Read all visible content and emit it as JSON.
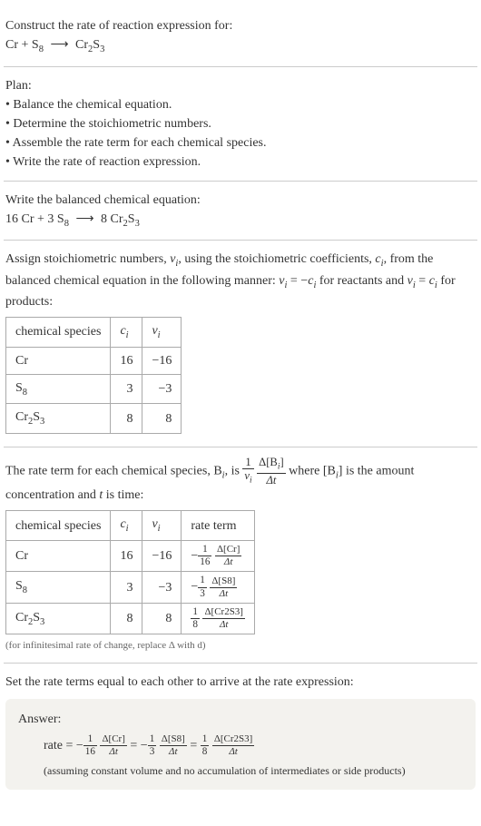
{
  "intro": {
    "prompt": "Construct the rate of reaction expression for:",
    "equation_lhs_1": "Cr",
    "equation_plus": " + ",
    "equation_lhs_2": "S",
    "equation_lhs_2_sub": "8",
    "equation_arrow": "⟶",
    "equation_rhs": "Cr",
    "equation_rhs_sub1": "2",
    "equation_rhs_s": "S",
    "equation_rhs_sub2": "3"
  },
  "plan": {
    "heading": "Plan:",
    "b1": "• Balance the chemical equation.",
    "b2": "• Determine the stoichiometric numbers.",
    "b3": "• Assemble the rate term for each chemical species.",
    "b4": "• Write the rate of reaction expression."
  },
  "balanced": {
    "heading": "Write the balanced chemical equation:",
    "c1": "16 Cr",
    "plus": " + ",
    "c2a": "3 S",
    "c2sub": "8",
    "arrow": "⟶",
    "c3a": "8 Cr",
    "c3sub1": "2",
    "c3b": "S",
    "c3sub2": "3"
  },
  "stoich": {
    "text1": "Assign stoichiometric numbers, ",
    "nu": "ν",
    "sub_i": "i",
    "text2": ", using the stoichiometric coefficients, ",
    "c": "c",
    "text3": ", from the balanced chemical equation in the following manner: ",
    "eq1_lhs": "ν",
    "eq1_eq": " = −",
    "eq1_rhs": "c",
    "text4": " for reactants and ",
    "eq2_eq": " = ",
    "text5": " for products:",
    "table": {
      "h1": "chemical species",
      "h2": "c",
      "h2sub": "i",
      "h3": "ν",
      "h3sub": "i",
      "r1c1": "Cr",
      "r1c2": "16",
      "r1c3": "−16",
      "r2c1": "S",
      "r2c1sub": "8",
      "r2c2": "3",
      "r2c3": "−3",
      "r3c1a": "Cr",
      "r3c1sub1": "2",
      "r3c1b": "S",
      "r3c1sub2": "3",
      "r3c2": "8",
      "r3c3": "8"
    }
  },
  "rateterm": {
    "text1": "The rate term for each chemical species, B",
    "sub_i": "i",
    "text2": ", is ",
    "frac1_num": "1",
    "frac1_den": "ν",
    "frac1_den_sub": "i",
    "frac2_num": "Δ[B",
    "frac2_num_sub": "i",
    "frac2_num_close": "]",
    "frac2_den": "Δt",
    "text3": " where [B",
    "text4": "] is the amount concentration and ",
    "t": "t",
    "text5": " is time:",
    "table": {
      "h1": "chemical species",
      "h2": "c",
      "h2sub": "i",
      "h3": "ν",
      "h3sub": "i",
      "h4": "rate term",
      "r1c1": "Cr",
      "r1c2": "16",
      "r1c3": "−16",
      "r1c4_sign": "−",
      "r1c4_f1n": "1",
      "r1c4_f1d": "16",
      "r1c4_f2n": "Δ[Cr]",
      "r1c4_f2d": "Δt",
      "r2c1": "S",
      "r2c1sub": "8",
      "r2c2": "3",
      "r2c3": "−3",
      "r2c4_sign": "−",
      "r2c4_f1n": "1",
      "r2c4_f1d": "3",
      "r2c4_f2n": "Δ[S8]",
      "r2c4_f2d": "Δt",
      "r3c1a": "Cr",
      "r3c1sub1": "2",
      "r3c1b": "S",
      "r3c1sub2": "3",
      "r3c2": "8",
      "r3c3": "8",
      "r3c4_f1n": "1",
      "r3c4_f1d": "8",
      "r3c4_f2n": "Δ[Cr2S3]",
      "r3c4_f2d": "Δt"
    },
    "note": "(for infinitesimal rate of change, replace Δ with d)"
  },
  "final": {
    "heading": "Set the rate terms equal to each other to arrive at the rate expression:"
  },
  "answer": {
    "label": "Answer:",
    "rate": "rate = ",
    "neg": "−",
    "f1n": "1",
    "f1d": "16",
    "g1n": "Δ[Cr]",
    "g1d": "Δt",
    "eq": " = ",
    "f2n": "1",
    "f2d": "3",
    "g2n": "Δ[S8]",
    "g2d": "Δt",
    "f3n": "1",
    "f3d": "8",
    "g3n": "Δ[Cr2S3]",
    "g3d": "Δt",
    "note": "(assuming constant volume and no accumulation of intermediates or side products)"
  }
}
